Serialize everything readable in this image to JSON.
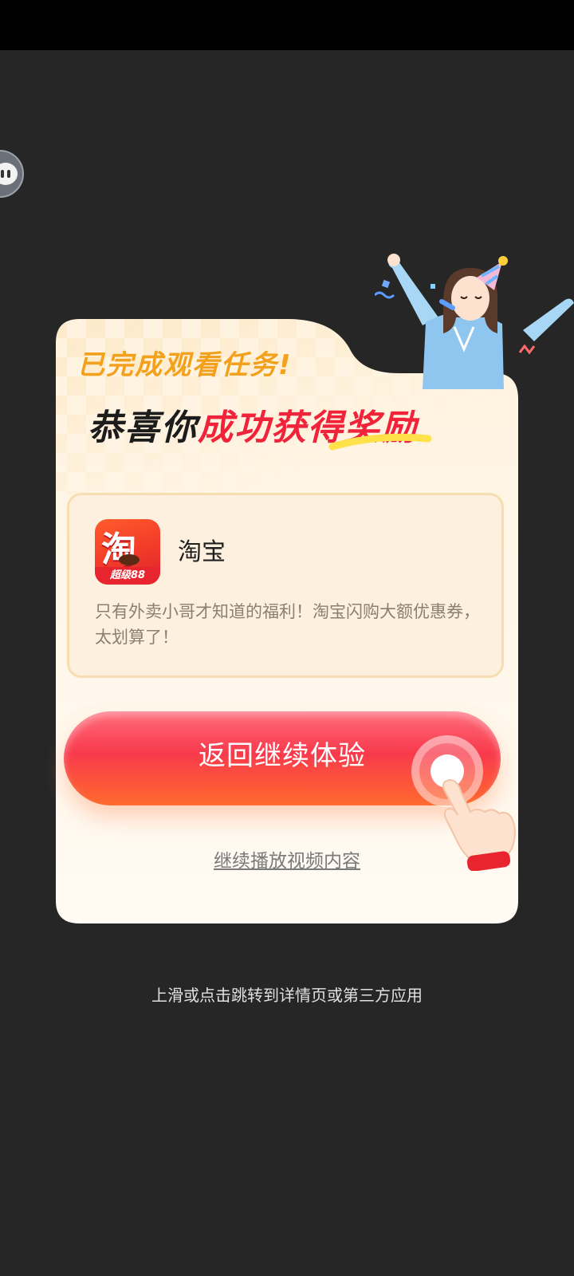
{
  "popup": {
    "task_done": "已完成观看任务!",
    "congrats_prefix": "恭喜你",
    "congrats_highlight": "成功获得奖励",
    "app": {
      "name": "淘宝",
      "icon_glyph": "淘",
      "icon_band": "超级88",
      "description": "只有外卖小哥才知道的福利！淘宝闪购大额优惠券，太划算了！"
    },
    "cta_label": "返回继续体验",
    "continue_link": "继续播放视频内容"
  },
  "footer_hint": "上滑或点击跳转到详情页或第三方应用",
  "colors": {
    "background": "#262626",
    "accent_red": "#f0233a",
    "accent_orange": "#f3a11c",
    "card": "#fffaf3"
  },
  "icons": [
    "chat-bubble-icon",
    "taobao-app-icon",
    "tap-hand-icon",
    "celebration-character"
  ]
}
